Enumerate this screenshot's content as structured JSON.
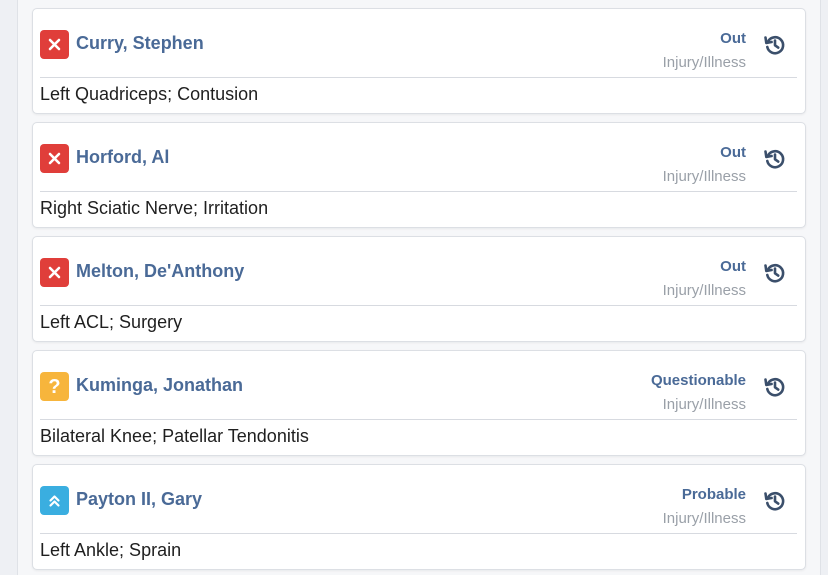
{
  "players": [
    {
      "name": "Curry, Stephen",
      "status": "Out",
      "status_type": "Injury/Illness",
      "injury": "Left Quadriceps; Contusion",
      "icon": "x-icon",
      "icon_color": "#e03e3a"
    },
    {
      "name": "Horford, Al",
      "status": "Out",
      "status_type": "Injury/Illness",
      "injury": "Right Sciatic Nerve; Irritation",
      "icon": "x-icon",
      "icon_color": "#e03e3a"
    },
    {
      "name": "Melton, De'Anthony",
      "status": "Out",
      "status_type": "Injury/Illness",
      "injury": "Left ACL; Surgery",
      "icon": "x-icon",
      "icon_color": "#e03e3a"
    },
    {
      "name": "Kuminga, Jonathan",
      "status": "Questionable",
      "status_type": "Injury/Illness",
      "injury": "Bilateral Knee; Patellar Tendonitis",
      "icon": "question-icon",
      "icon_color": "#f7b53c"
    },
    {
      "name": "Payton II, Gary",
      "status": "Probable",
      "status_type": "Injury/Illness",
      "injury": "Left Ankle; Sprain",
      "icon": "double-chevron-up-icon",
      "icon_color": "#3aaee0"
    }
  ],
  "colors": {
    "name": "#4a6a97",
    "muted": "#9aa0a8",
    "history_icon": "#3b4f6b"
  }
}
